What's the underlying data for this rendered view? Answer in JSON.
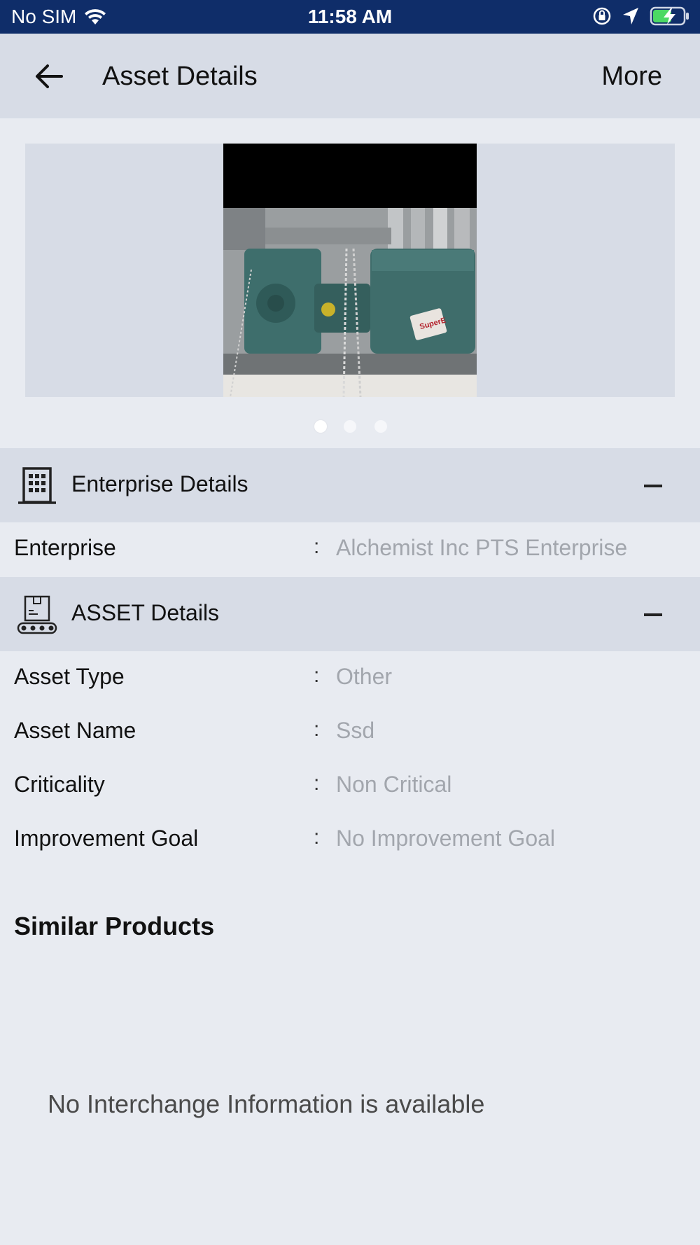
{
  "status_bar": {
    "carrier": "No SIM",
    "time": "11:58 AM"
  },
  "header": {
    "title": "Asset Details",
    "more_label": "More"
  },
  "carousel": {
    "photo_caption": "SuperE",
    "page_count": 3,
    "active_index": 0
  },
  "enterprise_section": {
    "title": "Enterprise Details",
    "rows": [
      {
        "label": "Enterprise",
        "value": "Alchemist Inc PTS Enterprise"
      }
    ]
  },
  "asset_section": {
    "title": "ASSET Details",
    "rows": [
      {
        "label": "Asset Type",
        "value": "Other"
      },
      {
        "label": "Asset Name",
        "value": "Ssd"
      },
      {
        "label": "Criticality",
        "value": "Non Critical"
      },
      {
        "label": "Improvement Goal",
        "value": "No Improvement Goal"
      }
    ]
  },
  "similar_products": {
    "title": "Similar Products",
    "empty_message": "No Interchange Information is available"
  },
  "separator": ":",
  "colors": {
    "status_bar": "#0f2d69",
    "header_bg": "#d7dce6",
    "page_bg": "#e8ebf1",
    "value_text": "#a2a6ad",
    "battery_fill": "#4cd964"
  }
}
